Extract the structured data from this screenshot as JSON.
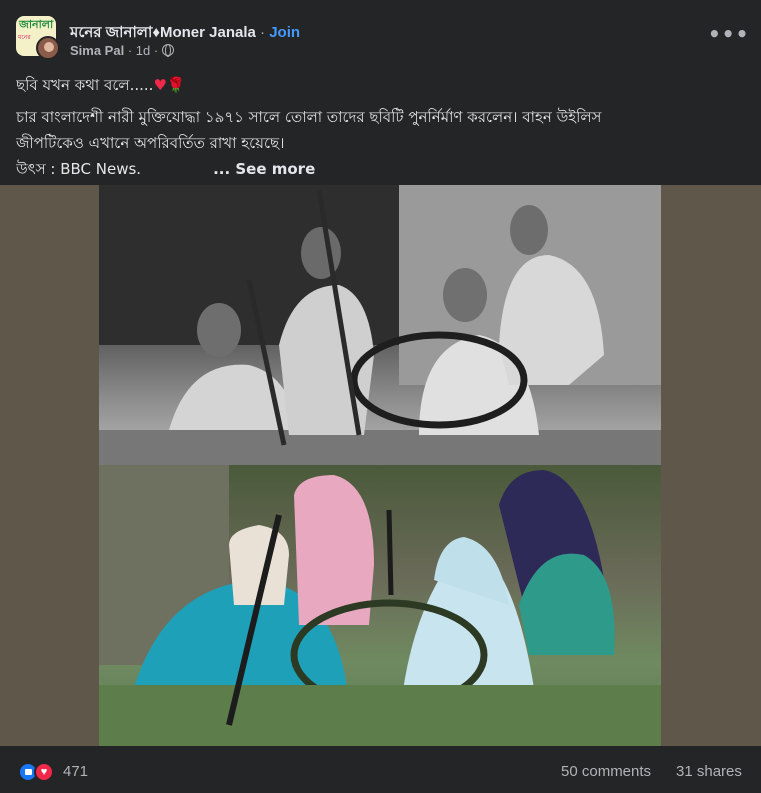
{
  "header": {
    "group_name": "মনের জানালা♦Moner Janala",
    "separator": "·",
    "join_label": "Join",
    "author": "Sima Pal",
    "time": "1d",
    "more_label": "•••",
    "group_logo_text": "জানালা",
    "group_logo_sub": "মনের"
  },
  "post": {
    "line1": "ছবি যখন কথা বলে.....",
    "line1_heart": "♥",
    "line1_rose": "🌹",
    "line2": "চার বাংলাদেশী নারী মুক্তিযোদ্ধা ১৯৭১ সালে তোলা তাদের ছবিটি পুনর্নির্মাণ করলেন। বাহন উইলিস",
    "line3": "জীপটিকেও এখানে অপরিবর্তিত রাখা হয়েছে।",
    "line4": "উৎস : BBC News.",
    "see_more": "... See more"
  },
  "footer": {
    "reaction_count": "471",
    "comments": "50 comments",
    "shares": "31 shares",
    "love_glyph": "♥"
  },
  "colors": {
    "background": "#242526",
    "text": "#e4e6eb",
    "secondary": "#b0b3b8",
    "join": "#4599ff",
    "like": "#1877f2",
    "love": "#f02849"
  }
}
